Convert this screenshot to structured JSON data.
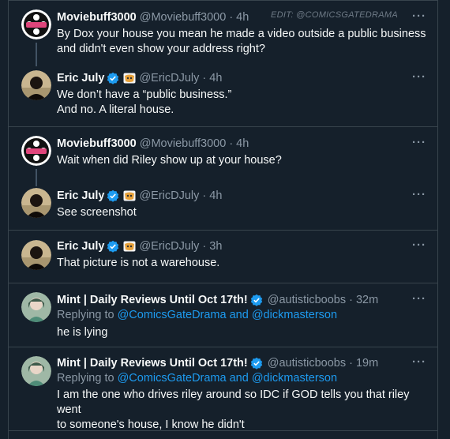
{
  "watermark": "EDIT: @COMICSGATEDRAMA",
  "more_glyph": "···",
  "verified_color": "#1d9bf0",
  "tweets": [
    {
      "name": "Moviebuff3000",
      "handle": "@Moviebuff3000",
      "time": "· 4h",
      "lines": [
        "By Dox your house you mean he made a video outside a public business",
        "and didn't even show your address right?"
      ],
      "avatar": "film-reel-avatar"
    },
    {
      "name": "Eric July",
      "handle": "@EricDJuly",
      "time": "· 4h",
      "lines": [
        "We don’t have a “public business.”",
        "And no. A literal house."
      ],
      "avatar": "person-avatar"
    },
    {
      "name": "Moviebuff3000",
      "handle": "@Moviebuff3000",
      "time": "· 4h",
      "lines": [
        "Wait when did Riley show up at your house?"
      ],
      "avatar": "film-reel-avatar"
    },
    {
      "name": "Eric July",
      "handle": "@EricDJuly",
      "time": "· 4h",
      "lines": [
        "See screenshot"
      ],
      "avatar": "person-avatar"
    },
    {
      "name": "Eric July",
      "handle": "@EricDJuly",
      "time": "· 3h",
      "lines": [
        "That picture is not a warehouse."
      ],
      "avatar": "person-avatar"
    },
    {
      "name": "Mint | Daily Reviews Until Oct 17th!",
      "handle": "@autisticboobs",
      "time": "· 32m",
      "replying_prefix": "Replying to",
      "replying_to": "@ComicsGateDrama and @dickmasterson",
      "lines": [
        "he is lying"
      ],
      "avatar": "anime-avatar"
    },
    {
      "name": "Mint | Daily Reviews Until Oct 17th!",
      "handle": "@autisticboobs",
      "time": "· 19m",
      "replying_prefix": "Replying to",
      "replying_to": "@ComicsGateDrama and @dickmasterson",
      "lines": [
        "I am the one who drives riley around so IDC if GOD tells you that riley went",
        "to someone's house, I know he didn't"
      ],
      "avatar": "anime-avatar"
    }
  ]
}
